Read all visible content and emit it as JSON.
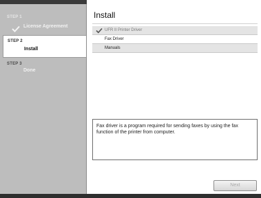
{
  "steps": [
    {
      "label": "STEP 1",
      "name": "License Agreement",
      "state": "completed"
    },
    {
      "label": "STEP 2",
      "name": "Install",
      "state": "current"
    },
    {
      "label": "STEP 3",
      "name": "Done",
      "state": "pending"
    }
  ],
  "main": {
    "title": "Install",
    "items": [
      {
        "label": "UFR II Printer Driver",
        "checked": true,
        "enabled": false
      },
      {
        "label": "Fax Driver",
        "checked": false,
        "enabled": true
      },
      {
        "label": "Manuals",
        "checked": false,
        "enabled": true
      }
    ],
    "description": "Fax driver is a program required for sending faxes by using the fax function of the printer from computer.",
    "next_label": "Next"
  },
  "colors": {
    "sidebar_bg": "#bdbdbd",
    "selected_step_bg": "#ffffff",
    "disabled_text": "#a8a8a8"
  }
}
